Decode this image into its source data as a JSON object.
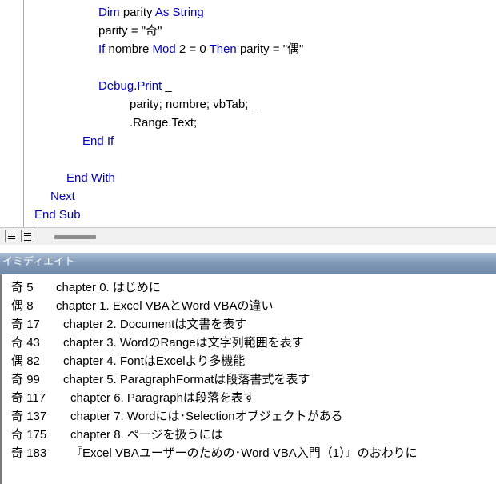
{
  "code": {
    "lines": [
      {
        "segments": [
          {
            "text": "Dim",
            "kw": true
          },
          {
            "text": " parity ",
            "kw": false
          },
          {
            "text": "As String",
            "kw": true
          }
        ]
      },
      {
        "segments": [
          {
            "text": "parity = \"奇\"",
            "kw": false
          }
        ]
      },
      {
        "segments": [
          {
            "text": "If",
            "kw": true
          },
          {
            "text": " nombre ",
            "kw": false
          },
          {
            "text": "Mod",
            "kw": true
          },
          {
            "text": " 2 = 0 ",
            "kw": false
          },
          {
            "text": "Then",
            "kw": true
          },
          {
            "text": " parity = \"偶\"",
            "kw": false
          }
        ]
      },
      {
        "segments": []
      },
      {
        "segments": [
          {
            "text": "Debug",
            "kw": true
          },
          {
            "text": ".",
            "kw": false
          },
          {
            "text": "Print",
            "kw": true
          },
          {
            "text": " _",
            "kw": false
          }
        ]
      },
      {
        "segments": [
          {
            "text": "parity; nombre; vbTab; _",
            "kw": false
          }
        ]
      },
      {
        "segments": [
          {
            "text": ".Range.Text;",
            "kw": false
          }
        ]
      },
      {
        "segments": [
          {
            "text": "End If",
            "kw": true
          }
        ]
      },
      {
        "segments": []
      },
      {
        "segments": [
          {
            "text": "End With",
            "kw": true
          }
        ]
      },
      {
        "segments": [
          {
            "text": "Next",
            "kw": true
          }
        ]
      },
      {
        "segments": [
          {
            "text": "End Sub",
            "kw": true
          }
        ]
      }
    ]
  },
  "view_buttons": [
    {
      "name": "procedure-view-icon"
    },
    {
      "name": "full-module-view-icon"
    }
  ],
  "immediate": {
    "title": "イミディエイト",
    "lines": [
      {
        "parity": "奇",
        "num": "5",
        "text": "chapter 0. はじめに"
      },
      {
        "parity": "偶",
        "num": "8",
        "text": "chapter 1. Excel VBAとWord VBAの違い"
      },
      {
        "parity": "奇",
        "num": "17",
        "text": "chapter 2. Documentは文書を表す"
      },
      {
        "parity": "奇",
        "num": "43",
        "text": "chapter 3. WordのRangeは文字列範囲を表す"
      },
      {
        "parity": "偶",
        "num": "82",
        "text": "chapter 4. FontはExcelより多機能"
      },
      {
        "parity": "奇",
        "num": "99",
        "text": "chapter 5. ParagraphFormatは段落書式を表す"
      },
      {
        "parity": "奇",
        "num": "117",
        "text": "chapter 6. Paragraphは段落を表す"
      },
      {
        "parity": "奇",
        "num": "137",
        "text": "chapter 7. Wordには･Selectionオブジェクトがある"
      },
      {
        "parity": "奇",
        "num": "175",
        "text": "chapter 8. ページを扱うには"
      },
      {
        "parity": "奇",
        "num": "183",
        "text": "『Excel VBAユーザーのための･Word VBA入門（1）』のおわりに"
      }
    ]
  },
  "colors": {
    "keyword": "#0000cc",
    "text": "#000000",
    "immediate_title_bg": "#7f98b6"
  }
}
